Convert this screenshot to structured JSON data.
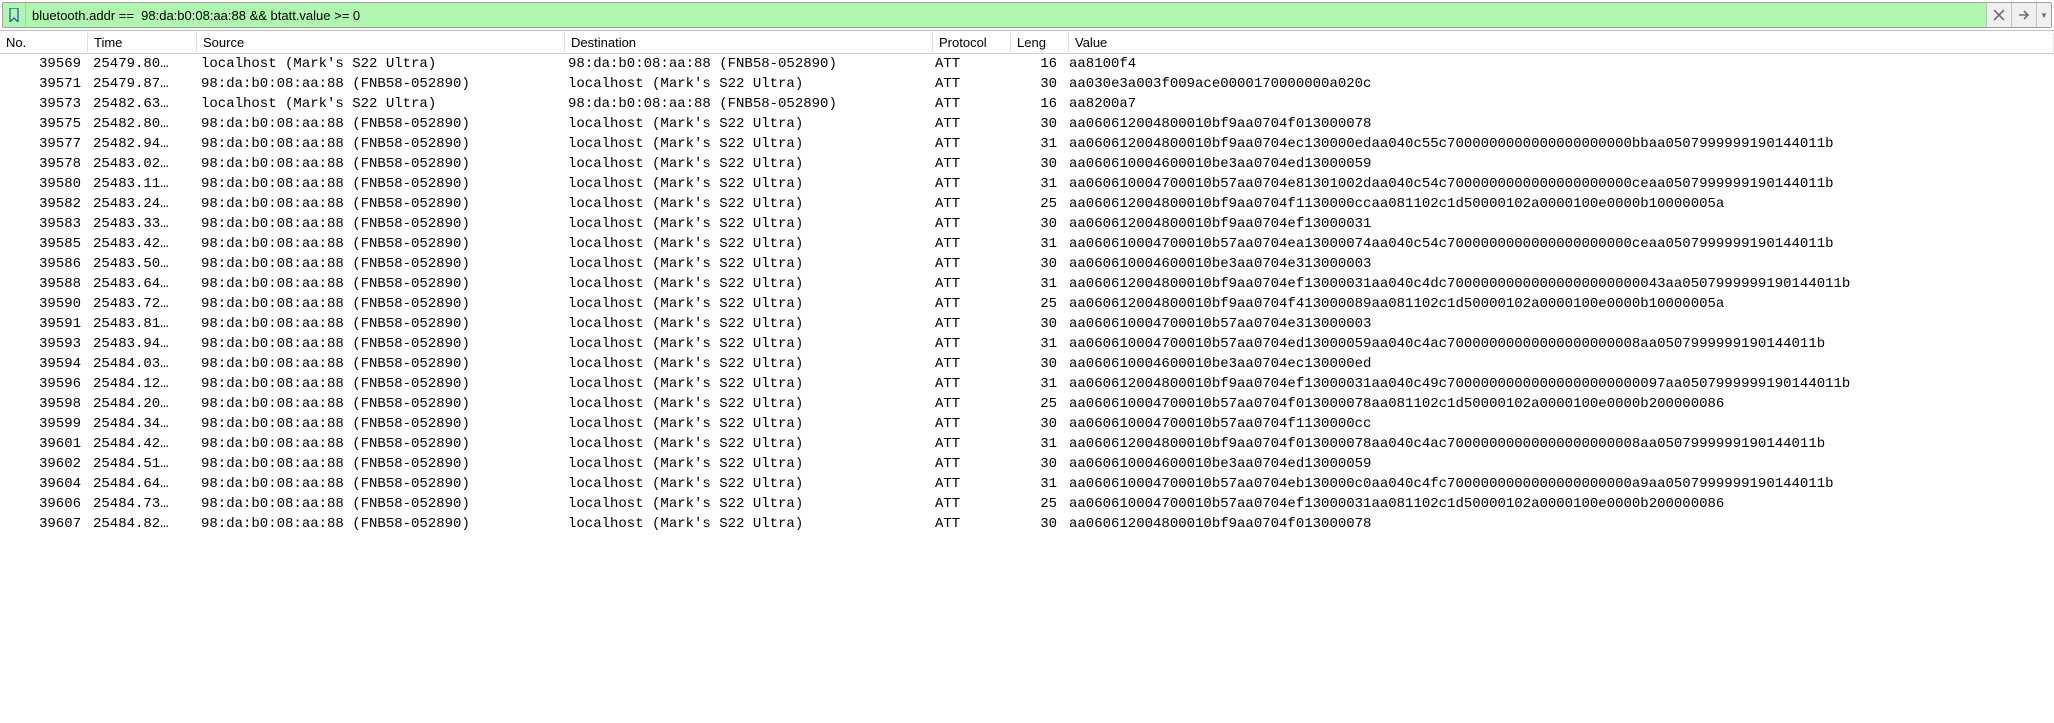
{
  "filter": {
    "expression": "bluetooth.addr ==  98:da:b0:08:aa:88 && btatt.value >= 0"
  },
  "columns": {
    "no": "No.",
    "time": "Time",
    "source": "Source",
    "destination": "Destination",
    "protocol": "Protocol",
    "length": "Leng",
    "value": "Value"
  },
  "hosts": {
    "local": "localhost (Mark's S22 Ultra)",
    "remote": "98:da:b0:08:aa:88 (FNB58-052890)"
  },
  "packets": [
    {
      "no": "39569",
      "time": "25479.80…",
      "src": "local",
      "dst": "remote",
      "proto": "ATT",
      "len": "16",
      "val": "aa8100f4"
    },
    {
      "no": "39571",
      "time": "25479.87…",
      "src": "remote",
      "dst": "local",
      "proto": "ATT",
      "len": "30",
      "val": "aa030e3a003f009ace0000170000000a020c"
    },
    {
      "no": "39573",
      "time": "25482.63…",
      "src": "local",
      "dst": "remote",
      "proto": "ATT",
      "len": "16",
      "val": "aa8200a7"
    },
    {
      "no": "39575",
      "time": "25482.80…",
      "src": "remote",
      "dst": "local",
      "proto": "ATT",
      "len": "30",
      "val": "aa060612004800010bf9aa0704f013000078"
    },
    {
      "no": "39577",
      "time": "25482.94…",
      "src": "remote",
      "dst": "local",
      "proto": "ATT",
      "len": "31",
      "val": "aa060612004800010bf9aa0704ec130000edaa040c55c7000000000000000000000bbaa0507999999190144011b"
    },
    {
      "no": "39578",
      "time": "25483.02…",
      "src": "remote",
      "dst": "local",
      "proto": "ATT",
      "len": "30",
      "val": "aa060610004600010be3aa0704ed13000059"
    },
    {
      "no": "39580",
      "time": "25483.11…",
      "src": "remote",
      "dst": "local",
      "proto": "ATT",
      "len": "31",
      "val": "aa060610004700010b57aa0704e81301002daa040c54c7000000000000000000000ceaa0507999999190144011b"
    },
    {
      "no": "39582",
      "time": "25483.24…",
      "src": "remote",
      "dst": "local",
      "proto": "ATT",
      "len": "25",
      "val": "aa060612004800010bf9aa0704f1130000ccaa081102c1d50000102a0000100e0000b10000005a"
    },
    {
      "no": "39583",
      "time": "25483.33…",
      "src": "remote",
      "dst": "local",
      "proto": "ATT",
      "len": "30",
      "val": "aa060612004800010bf9aa0704ef13000031"
    },
    {
      "no": "39585",
      "time": "25483.42…",
      "src": "remote",
      "dst": "local",
      "proto": "ATT",
      "len": "31",
      "val": "aa060610004700010b57aa0704ea13000074aa040c54c7000000000000000000000ceaa0507999999190144011b"
    },
    {
      "no": "39586",
      "time": "25483.50…",
      "src": "remote",
      "dst": "local",
      "proto": "ATT",
      "len": "30",
      "val": "aa060610004600010be3aa0704e313000003"
    },
    {
      "no": "39588",
      "time": "25483.64…",
      "src": "remote",
      "dst": "local",
      "proto": "ATT",
      "len": "31",
      "val": "aa060612004800010bf9aa0704ef13000031aa040c4dc70000000000000000000000043aa0507999999190144011b"
    },
    {
      "no": "39590",
      "time": "25483.72…",
      "src": "remote",
      "dst": "local",
      "proto": "ATT",
      "len": "25",
      "val": "aa060612004800010bf9aa0704f413000089aa081102c1d50000102a0000100e0000b10000005a"
    },
    {
      "no": "39591",
      "time": "25483.81…",
      "src": "remote",
      "dst": "local",
      "proto": "ATT",
      "len": "30",
      "val": "aa060610004700010b57aa0704e313000003"
    },
    {
      "no": "39593",
      "time": "25483.94…",
      "src": "remote",
      "dst": "local",
      "proto": "ATT",
      "len": "31",
      "val": "aa060610004700010b57aa0704ed13000059aa040c4ac70000000000000000000008aa0507999999190144011b"
    },
    {
      "no": "39594",
      "time": "25484.03…",
      "src": "remote",
      "dst": "local",
      "proto": "ATT",
      "len": "30",
      "val": "aa060610004600010be3aa0704ec130000ed"
    },
    {
      "no": "39596",
      "time": "25484.12…",
      "src": "remote",
      "dst": "local",
      "proto": "ATT",
      "len": "31",
      "val": "aa060612004800010bf9aa0704ef13000031aa040c49c70000000000000000000000097aa0507999999190144011b"
    },
    {
      "no": "39598",
      "time": "25484.20…",
      "src": "remote",
      "dst": "local",
      "proto": "ATT",
      "len": "25",
      "val": "aa060610004700010b57aa0704f013000078aa081102c1d50000102a0000100e0000b200000086"
    },
    {
      "no": "39599",
      "time": "25484.34…",
      "src": "remote",
      "dst": "local",
      "proto": "ATT",
      "len": "30",
      "val": "aa060610004700010b57aa0704f1130000cc"
    },
    {
      "no": "39601",
      "time": "25484.42…",
      "src": "remote",
      "dst": "local",
      "proto": "ATT",
      "len": "31",
      "val": "aa060612004800010bf9aa0704f013000078aa040c4ac70000000000000000000008aa0507999999190144011b"
    },
    {
      "no": "39602",
      "time": "25484.51…",
      "src": "remote",
      "dst": "local",
      "proto": "ATT",
      "len": "30",
      "val": "aa060610004600010be3aa0704ed13000059"
    },
    {
      "no": "39604",
      "time": "25484.64…",
      "src": "remote",
      "dst": "local",
      "proto": "ATT",
      "len": "31",
      "val": "aa060610004700010b57aa0704eb130000c0aa040c4fc7000000000000000000000a9aa0507999999190144011b"
    },
    {
      "no": "39606",
      "time": "25484.73…",
      "src": "remote",
      "dst": "local",
      "proto": "ATT",
      "len": "25",
      "val": "aa060610004700010b57aa0704ef13000031aa081102c1d50000102a0000100e0000b200000086"
    },
    {
      "no": "39607",
      "time": "25484.82…",
      "src": "remote",
      "dst": "local",
      "proto": "ATT",
      "len": "30",
      "val": "aa060612004800010bf9aa0704f013000078"
    }
  ]
}
